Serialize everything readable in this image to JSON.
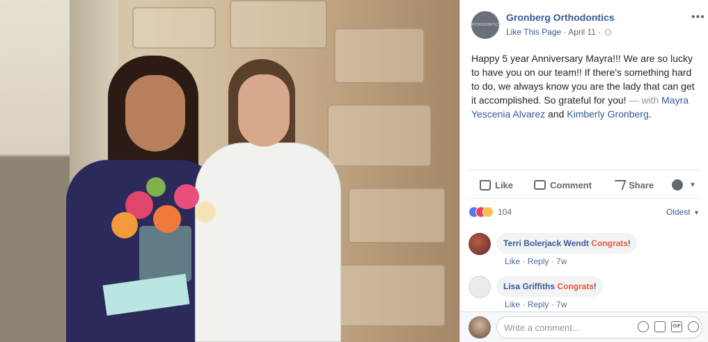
{
  "post": {
    "page_name": "Gronberg Orthodontics",
    "avatar_logo_text": "ORTHODONTICS",
    "like_page": "Like This Page",
    "date": "April 11",
    "text_main": "Happy 5 year Anniversary Mayra!!! We are so lucky to have you on our team!! If there's something hard to do, we always know you are the lady that can get it accomplished. So grateful for you!",
    "with_label": " — with ",
    "tag1": "Mayra Yescenia Alvarez",
    "and_label": " and ",
    "tag2": "Kimberly Gronberg",
    "period": "."
  },
  "actions": {
    "like": "Like",
    "comment": "Comment",
    "share": "Share"
  },
  "reactions": {
    "count": "104",
    "sort": "Oldest"
  },
  "comments": [
    {
      "author": "Terri Bolerjack Wendt",
      "text": "Congrats",
      "suffix": "!",
      "like": "Like",
      "reply": "Reply",
      "age": "7w"
    },
    {
      "author": "Lisa Griffiths",
      "text": "Congrats",
      "suffix": "!",
      "like": "Like",
      "reply": "Reply",
      "age": "7w"
    }
  ],
  "composer": {
    "placeholder": "Write a comment...",
    "gif_label": "GIF"
  },
  "colors": {
    "link": "#385898",
    "hashtag": "#e9573f",
    "text": "#1d2129",
    "muted": "#606770"
  }
}
